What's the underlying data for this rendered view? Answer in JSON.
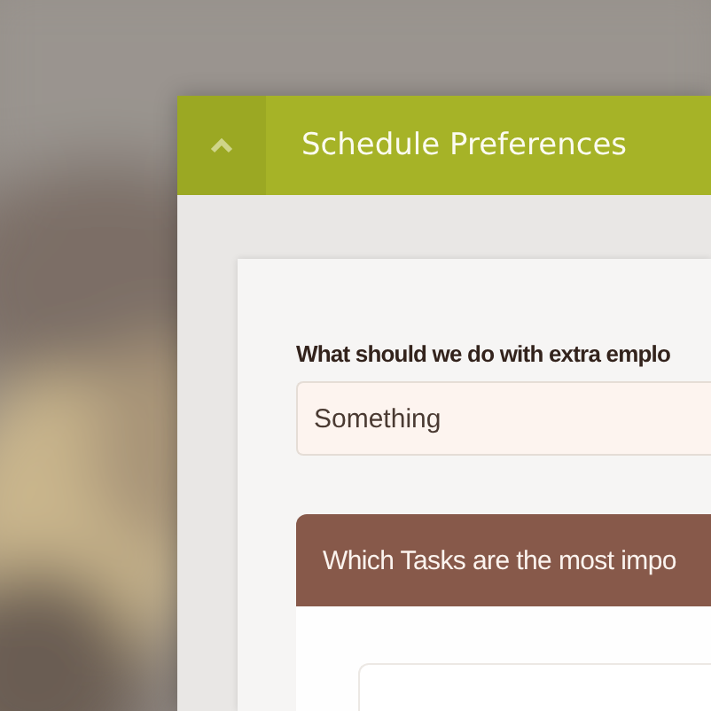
{
  "panel": {
    "title": "Schedule Preferences",
    "expanded": true
  },
  "question": {
    "label": "What should we do with extra emplo",
    "value": "Something"
  },
  "tasks": {
    "heading": "Which Tasks are the most impo"
  }
}
